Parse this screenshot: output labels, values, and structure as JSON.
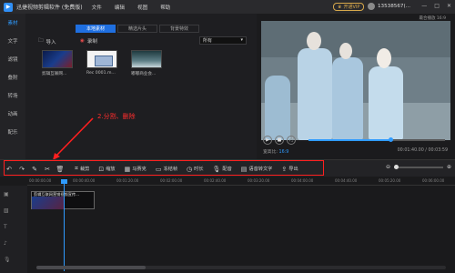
{
  "titlebar": {
    "app_title": "迅捷视频剪辑软件 (免费版)",
    "menu": [
      "文件",
      "编辑",
      "视图",
      "帮助"
    ],
    "vip_label": "开通VIP",
    "username": "13538567(...",
    "controls": [
      "—",
      "□",
      "✕"
    ]
  },
  "leftnav": {
    "items": [
      "素材",
      "文字",
      "滤镜",
      "叠附",
      "转场",
      "动画",
      "配乐"
    ]
  },
  "media": {
    "tabs": [
      "本地素材",
      "精选片头",
      "背景特效"
    ],
    "import_label": "导入",
    "record_label": "录制",
    "filter_value": "所有",
    "items": [
      {
        "caption": "剪辑互联网..."
      },
      {
        "caption": "Rec 0001.m..."
      },
      {
        "caption": "嘟嘟商业会..."
      }
    ]
  },
  "preview": {
    "ratio_top": "最合播放 16:9",
    "ratio_label": "宽高比:",
    "ratio_value": "16:9",
    "timecode": "00:01:40.00 / 00:03:59",
    "progress": 0.6
  },
  "annotation": {
    "text": "2.分割、删除"
  },
  "toolbar": {
    "tools": [
      {
        "icon": "crop-icon",
        "label": "裁剪"
      },
      {
        "icon": "zoom-icon",
        "label": "缩放"
      },
      {
        "icon": "mosaic-icon",
        "label": "马赛克"
      },
      {
        "icon": "freeze-icon",
        "label": "冻结帧"
      },
      {
        "icon": "speed-icon",
        "label": "时长"
      },
      {
        "icon": "dub-icon",
        "label": "配音"
      },
      {
        "icon": "speech-text-icon",
        "label": "语音转文字"
      },
      {
        "icon": "export-icon",
        "label": "导出"
      }
    ]
  },
  "timeline": {
    "ruler": [
      "00:00:00.00",
      "00:00:40.00",
      "00:01:20.00",
      "00:02:00.00",
      "00:02:40.00",
      "00:03:20.00",
      "00:04:00.00",
      "00:04:40.00",
      "00:05:20.00",
      "00:06:00.00"
    ],
    "clip_label": "剪辑互联网营销视频宣传..."
  }
}
